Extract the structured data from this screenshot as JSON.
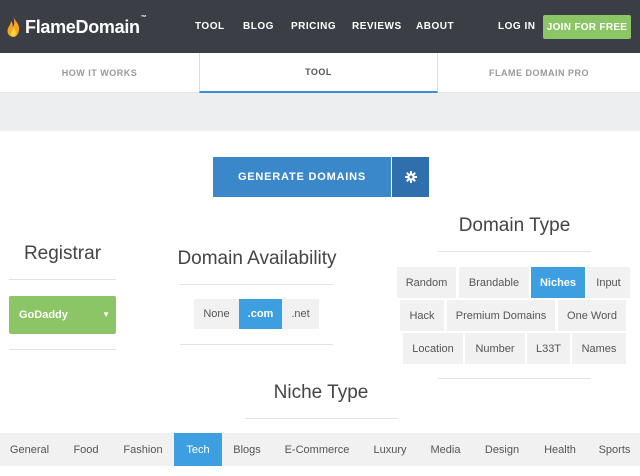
{
  "brand": {
    "name": "FlameDomain",
    "trademark": "™"
  },
  "nav": {
    "items": [
      "TOOL",
      "BLOG",
      "PRICING",
      "REVIEWS",
      "ABOUT"
    ],
    "login": "LOG IN",
    "join": "JOIN FOR FREE"
  },
  "tabs": [
    {
      "label": "HOW IT WORKS",
      "active": false
    },
    {
      "label": "TOOL",
      "active": true
    },
    {
      "label": "FLAME DOMAIN PRO",
      "active": false
    }
  ],
  "generate": {
    "label": "GENERATE DOMAINS",
    "settings_icon": "gear-icon"
  },
  "registrar": {
    "title": "Registrar",
    "selected": "GoDaddy",
    "caret": "▼"
  },
  "availability": {
    "title": "Domain Availability",
    "options": [
      "None",
      ".com",
      ".net"
    ],
    "selected": ".com"
  },
  "domain_type": {
    "title": "Domain Type",
    "rows": [
      [
        "Random",
        "Brandable",
        "Niches",
        "Input"
      ],
      [
        "Hack",
        "Premium Domains",
        "One Word"
      ],
      [
        "Location",
        "Number",
        "L33T",
        "Names"
      ]
    ],
    "selected": "Niches"
  },
  "niche_type": {
    "title": "Niche Type",
    "options": [
      "General",
      "Food",
      "Fashion",
      "Tech",
      "Blogs",
      "E-Commerce",
      "Luxury",
      "Media",
      "Design",
      "Health",
      "Sports"
    ],
    "selected": "Tech"
  },
  "colors": {
    "nav_bg": "#3b3e44",
    "accent_blue": "#3d9fe0",
    "button_blue": "#3a88c9",
    "green": "#8bc565"
  }
}
